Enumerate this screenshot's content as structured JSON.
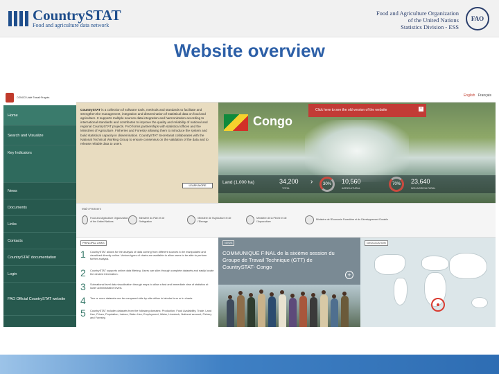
{
  "header": {
    "brand_name": "CountrySTAT",
    "brand_tagline": "Food and agriculture data network",
    "org_line1": "Food and Agriculture Organization",
    "org_line2": "of the United Nations",
    "org_line3": "Statistics Division - ESS",
    "org_logo": "FAO"
  },
  "slide_title": "Website overview",
  "site": {
    "sidebar": {
      "logo_text": "CONGO Unité·Travail·Progrès",
      "items": [
        {
          "label": "Home"
        },
        {
          "label": "Search and Visualize"
        },
        {
          "label": "Key Indicators"
        },
        {
          "label": "News"
        },
        {
          "label": "Documents"
        },
        {
          "label": "Links"
        },
        {
          "label": "Contacts"
        },
        {
          "label": "CountrySTAT documentation"
        },
        {
          "label": "Login"
        },
        {
          "label": "FAO Official CountrySTAT website"
        }
      ]
    },
    "lang": {
      "english": "English",
      "french": "Français"
    },
    "intro": {
      "lead": "CountrySTAT",
      "text": " is a collection of software tools, methods and standards to facilitate and strengthen the management, integration and dissemination of statistical data on food and agriculture. It supports multiple sources data integration and harmonization according to international standards and contributes to improve the quality and reliability of national and regional CountrySTAT projects. FAO forms partnerships with statistical offices and the Ministries of Agriculture, Fisheries and Forestry allowing them to introduce the system and build statistical capacity in dissemination. CountrySTAT Secretariat collaborates with the National Technical Working Group to ensure consensus on the validation of the data and to release reliable data to users.",
      "learn_more": "LEARN MORE"
    },
    "country": "Congo",
    "popup": {
      "text": "Click here to see the old version of the website",
      "close": "×"
    },
    "stats": {
      "land_label": "Land (1,000 ha)",
      "total_value": "34,200",
      "total_label": "TOTAL",
      "agri_percent": "30%",
      "agri_value": "10,560",
      "agri_label": "AGRICULTURAL",
      "non_agri_percent": "70%",
      "non_agri_value": "23,640",
      "non_agri_label": "NON AGRICULTURAL",
      "arrow": "›"
    },
    "partners": {
      "title": "Main Partners",
      "items": [
        {
          "label": "Food and Agriculture Organization of the United Nations"
        },
        {
          "label": "Ministère du Plan et de l'Intégration"
        },
        {
          "label": "Ministère de l'Agriculture et de l'Elevage"
        },
        {
          "label": "Ministère de la Pêche et de l'Aquaculture"
        },
        {
          "label": "Ministère de l'Economie Forestière et du Développement Durable"
        }
      ]
    },
    "steps": {
      "tag": "PRINCIPAL LINKS",
      "items": [
        {
          "num": "1",
          "text": "CountrySTAT allows for the analysis of data coming from different sources to be manipulated and visualized directly online. Various types of charts are available to allow users to be able to perform further analysis."
        },
        {
          "num": "2",
          "text": "CountrySTAT supports online data filtering. Users can skim through complete datasets and easily locate the desired information."
        },
        {
          "num": "3",
          "text": "Subnational level data visualization through maps to allow a fast and immediate view of statistics at lower administrative levels."
        },
        {
          "num": "4",
          "text": "Two or more datasets can be compared side by side either in tabular form or in charts."
        },
        {
          "num": "5",
          "text": "CountrySTAT includes datasets from the following domains: Production, Food Availability, Trade, Land Use, Prices, Population, Labour, Water Use, Employment, Water, Livestock, National account, Fishery and Forestry."
        }
      ]
    },
    "news": {
      "tag": "NEWS",
      "headline": "COMMUNIQUE FINAL de la sixième session du Groupe de Travail Technique (GTT) de CountrySTAT- Congo",
      "plus": "+"
    },
    "geo": {
      "tag": "GEOLOCATION"
    }
  },
  "colors": {
    "sidebar": "#27594e",
    "accent_red": "#c23b36",
    "title_blue": "#2c5fa7",
    "brand_blue": "#1f4e8c"
  }
}
